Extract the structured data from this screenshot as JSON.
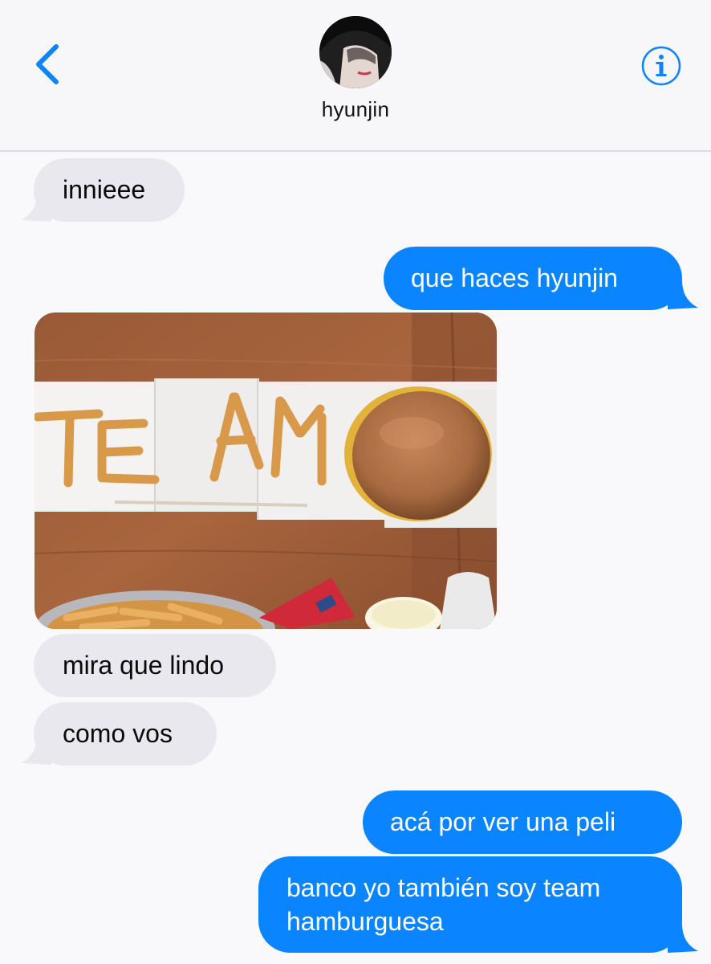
{
  "header": {
    "contact_name": "hyunjin",
    "back_icon": "chevron-left-icon",
    "info_icon": "info-circle-icon",
    "accent_color": "#0a84ff"
  },
  "messages": [
    {
      "direction": "received",
      "text": "innieee"
    },
    {
      "direction": "sent",
      "text": "que haces hyunjin"
    },
    {
      "direction": "received",
      "type": "image",
      "overlay_text": "TE AM"
    },
    {
      "direction": "received",
      "text": "mira que lindo"
    },
    {
      "direction": "received",
      "text": "como vos"
    },
    {
      "direction": "sent",
      "text": "acá por ver una peli"
    },
    {
      "direction": "sent",
      "text_lines": [
        "banco yo también soy team",
        "hamburguesa"
      ]
    }
  ],
  "colors": {
    "sent_bubble": "#0a84ff",
    "received_bubble": "#e9e8ee",
    "background": "#f9f9fb"
  }
}
